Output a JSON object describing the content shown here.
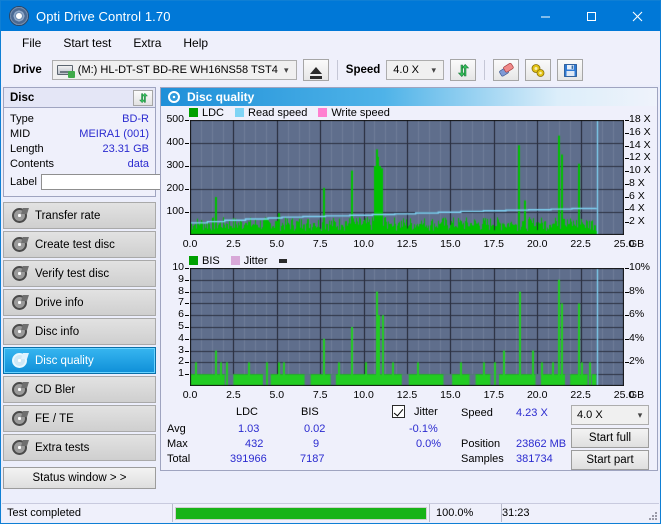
{
  "window": {
    "title": "Opti Drive Control 1.70",
    "icon": "disc-icon",
    "minimize": "minimize-icon",
    "maximize": "maximize-icon",
    "close": "close-icon"
  },
  "menu": {
    "items": [
      "File",
      "Start test",
      "Extra",
      "Help"
    ]
  },
  "toolbar": {
    "drive_label": "Drive",
    "drive_value": "(M:)  HL-DT-ST BD-RE  WH16NS58 TST4",
    "eject_icon": "eject-icon",
    "speed_label": "Speed",
    "speed_value": "4.0 X",
    "refresh_icon": "refresh-icon",
    "erase_icon": "eraser-icon",
    "settings_icon": "gears-icon",
    "save_icon": "floppy-save-icon"
  },
  "disc_panel": {
    "header": "Disc",
    "refresh_icon": "refresh-arrows-icon",
    "rows": [
      {
        "key": "Type",
        "value": "BD-R"
      },
      {
        "key": "MID",
        "value": "MEIRA1 (001)"
      },
      {
        "key": "Length",
        "value": "23.31 GB"
      },
      {
        "key": "Contents",
        "value": "data"
      }
    ],
    "label_key": "Label",
    "label_value": "",
    "label_placeholder": "",
    "disc_icon": "disc-small-icon"
  },
  "sidebar": {
    "items": [
      {
        "label": "Transfer rate",
        "selected": false
      },
      {
        "label": "Create test disc",
        "selected": false
      },
      {
        "label": "Verify test disc",
        "selected": false
      },
      {
        "label": "Drive info",
        "selected": false
      },
      {
        "label": "Disc info",
        "selected": false
      },
      {
        "label": "Disc quality",
        "selected": true
      },
      {
        "label": "CD Bler",
        "selected": false
      },
      {
        "label": "FE / TE",
        "selected": false
      },
      {
        "label": "Extra tests",
        "selected": false
      }
    ],
    "status_window_button": "Status window > >"
  },
  "panel": {
    "title": "Disc quality",
    "icon": "disc-quality-icon"
  },
  "stats": {
    "col_headers": [
      "LDC",
      "BIS"
    ],
    "row_headers": [
      "Avg",
      "Max",
      "Total"
    ],
    "ldc": {
      "avg": "1.03",
      "max": "432",
      "total": "391966"
    },
    "bis": {
      "avg": "0.02",
      "max": "9",
      "total": "7187"
    },
    "jitter": {
      "label": "Jitter",
      "checked": true,
      "avg": "-0.1%",
      "max": "0.0%"
    },
    "speed_label": "Speed",
    "speed_value": "4.23 X",
    "position_label": "Position",
    "position_value": "23862 MB",
    "samples_label": "Samples",
    "samples_value": "381734",
    "speed_select": "4.0 X",
    "start_full": "Start full",
    "start_part": "Start part"
  },
  "statusbar": {
    "message": "Test completed",
    "percent_text": "100.0%",
    "percent_value": 100,
    "elapsed": "31:23"
  },
  "colors": {
    "accent": "#0078d7",
    "plot_bg": "#5f6e8c",
    "ldc_green": "#00c000",
    "bis_green": "#22cc22",
    "read_speed": "#7fd4f5",
    "write_speed": "#ff7fd0",
    "jitter": "#d8a8d8",
    "value_blue": "#2b2bd0",
    "progress_green": "#18b318"
  },
  "chart_data": [
    {
      "type": "line",
      "name": "ldc-chart",
      "title": "",
      "legend": [
        {
          "label": "LDC",
          "color": "#00a000"
        },
        {
          "label": "Read speed",
          "color": "#7fd4f5"
        },
        {
          "label": "Write speed",
          "color": "#ff7fd0"
        }
      ],
      "legend_position": "top-left",
      "xlabel": "GB",
      "xlim": [
        0,
        25
      ],
      "xticks": [
        "0.0",
        "2.5",
        "5.0",
        "7.5",
        "10.0",
        "12.5",
        "15.0",
        "17.5",
        "20.0",
        "22.5",
        "25.0"
      ],
      "ylabel_left": "LDC",
      "ylim": [
        0,
        500
      ],
      "yticks_left": [
        "100",
        "200",
        "300",
        "400",
        "500"
      ],
      "ylabel_right": "X",
      "ylim_right": [
        0,
        18
      ],
      "yticks_right": [
        "2 X",
        "4 X",
        "6 X",
        "8 X",
        "10 X",
        "12 X",
        "14 X",
        "16 X",
        "18 X"
      ],
      "grid": true,
      "data_end_gb": 23.4,
      "series": [
        {
          "name": "LDC",
          "color": "#00c000",
          "type": "spikes",
          "baseline": 18,
          "spikes": [
            [
              0.15,
              40
            ],
            [
              0.35,
              28
            ],
            [
              0.55,
              55
            ],
            [
              0.8,
              30
            ],
            [
              1.05,
              35
            ],
            [
              1.25,
              45
            ],
            [
              1.45,
              165
            ],
            [
              1.6,
              40
            ],
            [
              1.85,
              30
            ],
            [
              2.1,
              48
            ],
            [
              2.35,
              30
            ],
            [
              2.6,
              38
            ],
            [
              2.9,
              26
            ],
            [
              3.15,
              52
            ],
            [
              3.4,
              30
            ],
            [
              3.7,
              44
            ],
            [
              4.0,
              30
            ],
            [
              4.3,
              36
            ],
            [
              4.6,
              28
            ],
            [
              4.9,
              60
            ],
            [
              5.05,
              95
            ],
            [
              5.3,
              38
            ],
            [
              5.6,
              30
            ],
            [
              5.9,
              42
            ],
            [
              6.2,
              30
            ],
            [
              6.5,
              46
            ],
            [
              6.8,
              30
            ],
            [
              7.1,
              52
            ],
            [
              7.4,
              34
            ],
            [
              7.65,
              205
            ],
            [
              7.85,
              48
            ],
            [
              8.1,
              36
            ],
            [
              8.4,
              30
            ],
            [
              8.7,
              44
            ],
            [
              8.95,
              60
            ],
            [
              9.25,
              280
            ],
            [
              9.45,
              42
            ],
            [
              9.75,
              38
            ],
            [
              10.0,
              55
            ],
            [
              10.25,
              44
            ],
            [
              10.5,
              62
            ],
            [
              10.62,
              300
            ],
            [
              10.7,
              372
            ],
            [
              10.78,
              340
            ],
            [
              10.88,
              300
            ],
            [
              10.98,
              290
            ],
            [
              11.15,
              75
            ],
            [
              11.45,
              48
            ],
            [
              11.7,
              40
            ],
            [
              12.0,
              52
            ],
            [
              12.3,
              36
            ],
            [
              12.6,
              44
            ],
            [
              12.9,
              30
            ],
            [
              13.2,
              48
            ],
            [
              13.5,
              36
            ],
            [
              13.8,
              42
            ],
            [
              14.1,
              30
            ],
            [
              14.4,
              50
            ],
            [
              14.7,
              38
            ],
            [
              15.0,
              44
            ],
            [
              15.3,
              32
            ],
            [
              15.6,
              46
            ],
            [
              15.9,
              34
            ],
            [
              16.2,
              42
            ],
            [
              16.5,
              30
            ],
            [
              16.8,
              48
            ],
            [
              17.1,
              36
            ],
            [
              17.4,
              44
            ],
            [
              17.7,
              38
            ],
            [
              18.0,
              50
            ],
            [
              18.3,
              36
            ],
            [
              18.6,
              44
            ],
            [
              18.9,
              390
            ],
            [
              19.1,
              60
            ],
            [
              19.25,
              150
            ],
            [
              19.5,
              42
            ],
            [
              19.8,
              38
            ],
            [
              20.1,
              50
            ],
            [
              20.4,
              36
            ],
            [
              20.7,
              44
            ],
            [
              21.0,
              60
            ],
            [
              21.2,
              432
            ],
            [
              21.35,
              350
            ],
            [
              21.5,
              70
            ],
            [
              21.8,
              46
            ],
            [
              22.1,
              40
            ],
            [
              22.35,
              310
            ],
            [
              22.5,
              55
            ],
            [
              22.8,
              48
            ],
            [
              23.1,
              60
            ],
            [
              23.3,
              42
            ]
          ]
        },
        {
          "name": "Read speed",
          "color": "#7fd4f5",
          "type": "step-line",
          "axis": "right",
          "points": [
            [
              0.0,
              1.9
            ],
            [
              1.0,
              2.1
            ],
            [
              2.0,
              2.3
            ],
            [
              3.2,
              2.5
            ],
            [
              4.5,
              2.65
            ],
            [
              5.3,
              2.8
            ],
            [
              6.5,
              2.9
            ],
            [
              7.8,
              3.0
            ],
            [
              9.2,
              3.1
            ],
            [
              10.5,
              3.2
            ],
            [
              11.8,
              3.3
            ],
            [
              13.0,
              3.45
            ],
            [
              14.3,
              3.55
            ],
            [
              15.6,
              3.7
            ],
            [
              16.9,
              3.8
            ],
            [
              18.2,
              3.9
            ],
            [
              19.5,
              3.95
            ],
            [
              20.8,
              4.05
            ],
            [
              22.0,
              4.15
            ],
            [
              23.4,
              4.2
            ]
          ]
        },
        {
          "name": "Write speed",
          "color": "#ff7fd0",
          "type": "step-line",
          "axis": "right",
          "points": []
        }
      ],
      "cursor_gb": 23.45
    },
    {
      "type": "line",
      "name": "bis-chart",
      "title": "",
      "legend": [
        {
          "label": "BIS",
          "color": "#00a000"
        },
        {
          "label": "Jitter",
          "color": "#d8a8d8"
        }
      ],
      "legend_position": "top-left",
      "xlabel": "GB",
      "xlim": [
        0,
        25
      ],
      "xticks": [
        "0.0",
        "2.5",
        "5.0",
        "7.5",
        "10.0",
        "12.5",
        "15.0",
        "17.5",
        "20.0",
        "22.5",
        "25.0"
      ],
      "ylabel_left": "BIS",
      "ylim": [
        0,
        10
      ],
      "yticks_left": [
        "1",
        "2",
        "3",
        "4",
        "5",
        "6",
        "7",
        "8",
        "9",
        "10"
      ],
      "ylabel_right": "Jitter %",
      "ylim_right": [
        0,
        10
      ],
      "yticks_right": [
        "2%",
        "4%",
        "6%",
        "8%",
        "10%"
      ],
      "grid": true,
      "data_end_gb": 23.4,
      "series": [
        {
          "name": "BIS",
          "color": "#22cc22",
          "type": "spikes",
          "baseline": 1,
          "spikes": [
            [
              0.3,
              2
            ],
            [
              1.45,
              3
            ],
            [
              1.75,
              2
            ],
            [
              2.05,
              2
            ],
            [
              3.35,
              2
            ],
            [
              4.35,
              2
            ],
            [
              5.05,
              2
            ],
            [
              5.35,
              2
            ],
            [
              7.65,
              4
            ],
            [
              8.55,
              2
            ],
            [
              9.25,
              5
            ],
            [
              10.1,
              2
            ],
            [
              10.72,
              8
            ],
            [
              10.82,
              6
            ],
            [
              11.05,
              6
            ],
            [
              11.65,
              2
            ],
            [
              13.1,
              2
            ],
            [
              15.55,
              2
            ],
            [
              16.9,
              2
            ],
            [
              17.5,
              2
            ],
            [
              18.05,
              3
            ],
            [
              18.95,
              8
            ],
            [
              19.7,
              3
            ],
            [
              20.2,
              2
            ],
            [
              20.85,
              2
            ],
            [
              21.2,
              9
            ],
            [
              21.35,
              7
            ],
            [
              22.35,
              7
            ],
            [
              22.55,
              2
            ],
            [
              23.0,
              2
            ]
          ]
        },
        {
          "name": "Jitter",
          "color": "#d8a8d8",
          "type": "line",
          "axis": "right",
          "points": []
        }
      ],
      "cursor_gb": 23.45
    }
  ]
}
